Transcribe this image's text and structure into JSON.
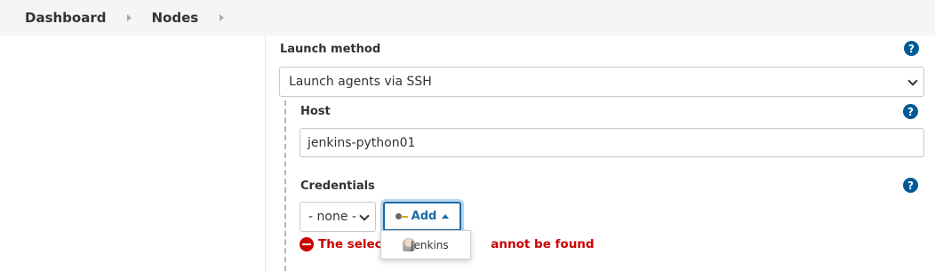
{
  "breadcrumb": {
    "items": [
      "Dashboard",
      "Nodes"
    ]
  },
  "launch_method": {
    "label": "Launch method",
    "selected": "Launch agents via SSH"
  },
  "host": {
    "label": "Host",
    "value": "jenkins-python01"
  },
  "credentials": {
    "label": "Credentials",
    "selected": "- none -",
    "add_label": "Add",
    "error_prefix": "The selecte",
    "error_suffix": "annot be found",
    "dropdown_item": "Jenkins"
  },
  "help_icon_glyph": "?",
  "colors": {
    "accent": "#1b6aa5",
    "error": "#cc0000",
    "help": "#005a96"
  }
}
